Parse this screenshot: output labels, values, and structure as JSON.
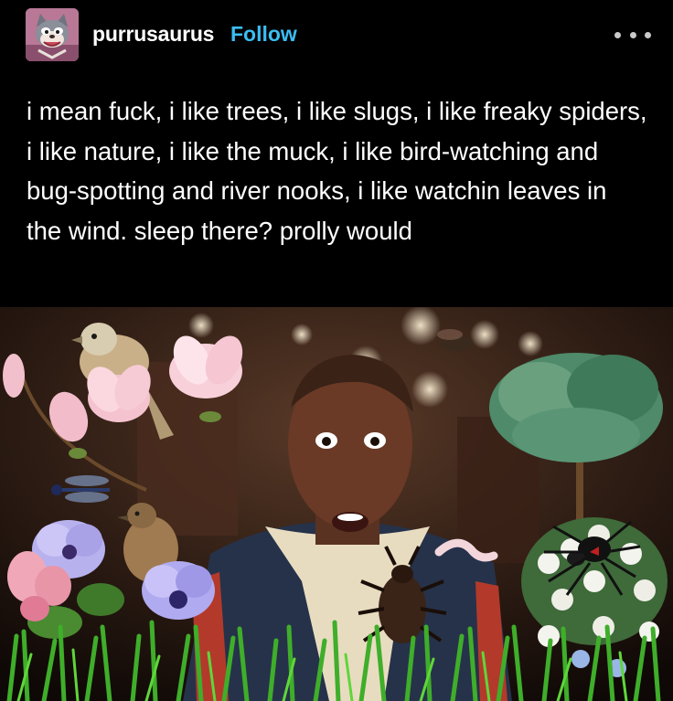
{
  "post": {
    "author": {
      "username": "purrusaurus",
      "follow_label": "Follow",
      "avatar_icon": "cartoon-cat-avatar-icon"
    },
    "menu_icon": "more-options-icon",
    "text": "i mean fuck, i like trees, i like slugs, i like freaky spiders, i like nature, i like the muck, i like bird-watching and bug-spotting and river nooks, i like watchin leaves in the wind. sleep there? prolly would",
    "media": {
      "kind": "image",
      "subjects": [
        "person-with-surprised-expression",
        "bird",
        "flowers",
        "tree",
        "spider",
        "beetle",
        "worm",
        "grass"
      ]
    }
  },
  "colors": {
    "background": "#000000",
    "text": "#ffffff",
    "follow": "#3bbdf2",
    "menu_dots": "#c8c8c8"
  }
}
